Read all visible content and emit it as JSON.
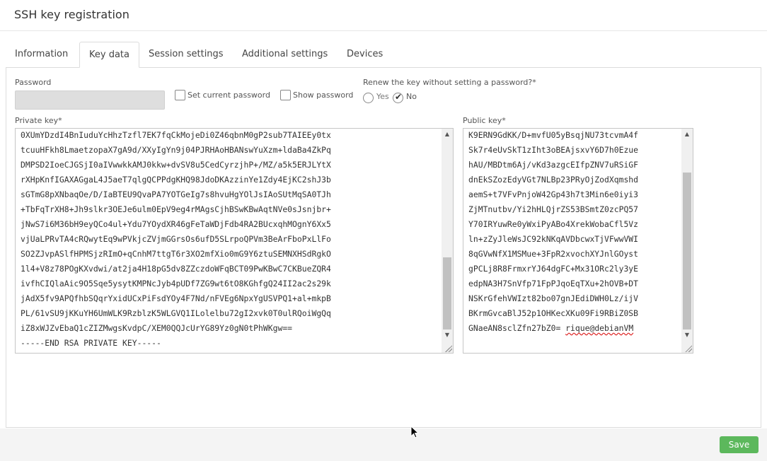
{
  "window": {
    "title": "SSH key registration"
  },
  "tabs": [
    {
      "label": "Information"
    },
    {
      "label": "Key data"
    },
    {
      "label": "Session settings"
    },
    {
      "label": "Additional settings"
    },
    {
      "label": "Devices"
    }
  ],
  "form": {
    "password_label": "Password",
    "password_value": "",
    "set_current_password_label": "Set current password",
    "show_password_label": "Show password",
    "renew_question": "Renew the key without setting a password?*",
    "renew_yes_label": "Yes",
    "renew_no_label": "No",
    "renew_selected": "No",
    "private_key_label": "Private key*",
    "private_key_lines": [
      "0XUmYDzdI4BnIuduYcHhzTzfl7EK7fqCkMojeDi0Z46qbnM0gP2sub7TAIEEy0tx",
      "tcuuHFkh8LmaetzopaX7gA9d/XXyIgYn9j04PJRHAoHBANswYuXzm+ldaBa4ZkPq",
      "DMPSD2IoeCJGSjI0aIVwwkkAMJ0kkw+dvSV8u5CedCyrzjhP+/MZ/a5k5ERJLYtX",
      "rXHpKnfIGAXAGgaL4J5aeT7qlgQCPPdgKHQ98JdoDKAzzinYe1Zdy4EjKC2shJ3b",
      "sGTmG8pXNbaqOe/D/IaBTEU9QvaPA7YOTGeIg7s8hvuHgYOlJsIAoSUtMqSA0TJh",
      "+TbFqTrXH8+Jh9slkr3OEJe6ulm0EpV9eg4rMAgsCjhBSwKBwAqtNVe0sJsnjbr+",
      "jNwS7i6M36bH9eyQCo4ul+Ydu7YOydXR46gFeTaWDjFdb4RA2BUcxqhMOgnY6Xx5",
      "vjUaLPRvTA4cRQwytEq9wPVkjcZVjmGGrsOs6ufD5SLrpoQPVm3BeArFboPxLlFo",
      "SO2ZJvpASlfHPMSjzRImO+qCnhM7ttgT6r3XO2mfXio0mG9Y6ztuSEMNXHSdRgkO",
      "1l4+V8z78POgKXvdwi/at2ja4H18pG5dv8ZZczdoWFqBCT09PwKBwC7CKBueZQR4",
      "ivfhCIQlaAic9O5Sqe5ysytKMPNcJyb4pUDf7ZG9wt6tO8KGhfgQ24II2ac2s29k",
      "jAdX5fv9APQfhbSQqrYxidUCxPiFsdYOy4F7Nd/nFVEg6NpxYgUSVPQ1+al+mkpB",
      "PL/61vSU9jKKuYH6UmWLK9RzblzK5WLGVQ1ILolelbu72gI2xvk0T0ulRQoiWgQq",
      "iZ8xWJZvEbaQ1cZIZMwgsKvdpC/XEM0QQJcUrYG89Yz0gN0tPhWKgw==",
      "-----END RSA PRIVATE KEY-----"
    ],
    "public_key_label": "Public key*",
    "public_key_lines": [
      "K9ERN9GdKK/D+mvfU05yBsqjNU73tcvmA4f",
      "Sk7r4eUvSkT1zIht3oBEAjsxvY6D7h0Ezue",
      "hAU/MBDtm6Aj/vKd3azgcEIfpZNV7uRSiGF",
      "dnEkSZozEdyVGt7NLBp23PRyOjZodXqmshd",
      "aemS+t7VFvPnjoW42Gp43h7t3Min6e0iyi3",
      "ZjMTnutbv/Yi2hHLQjrZS53BSmtZ0zcPQ57",
      "Y70IRYuwRe0yWxiPyABo4XrekWobaCfl5Vz",
      "ln+zZyJleWsJC92kNKqAVDbcwxTjVFwwVWI",
      "8qGVwNfX1MSMue+3FpR2xvochXYJnlGOyst",
      "gPCLj8R8FrmxrYJ64dgFC+Mx31ORc2ly3yE",
      "edpNA3H7SnVfp71FpPJqoEqTXu+2hOVB+DT",
      "NSKrGfehVWIzt82bo07gnJEdiDWH0Lz/ijV",
      "BKrmGvcaBlJ52p1OHKecXKu09Fi9RBiZ0SB",
      "GNaeAN8sclZfn27bZ0="
    ],
    "public_key_comment": "rique@debianVM"
  },
  "footer": {
    "save_label": "Save"
  }
}
